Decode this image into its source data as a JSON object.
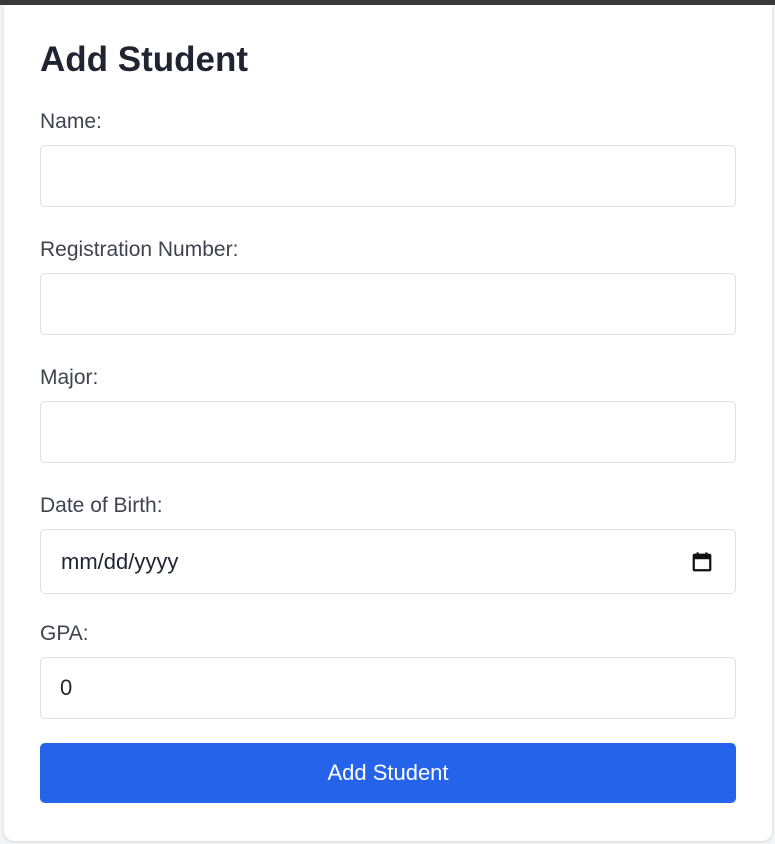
{
  "form": {
    "title": "Add Student",
    "fields": {
      "name": {
        "label": "Name:",
        "value": ""
      },
      "registration": {
        "label": "Registration Number:",
        "value": ""
      },
      "major": {
        "label": "Major:",
        "value": ""
      },
      "dob": {
        "label": "Date of Birth:",
        "placeholder": "mm/dd/yyyy",
        "icon": "calendar-icon"
      },
      "gpa": {
        "label": "GPA:",
        "value": "0"
      }
    },
    "submit_label": "Add Student"
  },
  "colors": {
    "button_bg": "#2563eb",
    "title_text": "#1f2430",
    "label_text": "#3f4450",
    "input_border": "#dde0e5"
  }
}
